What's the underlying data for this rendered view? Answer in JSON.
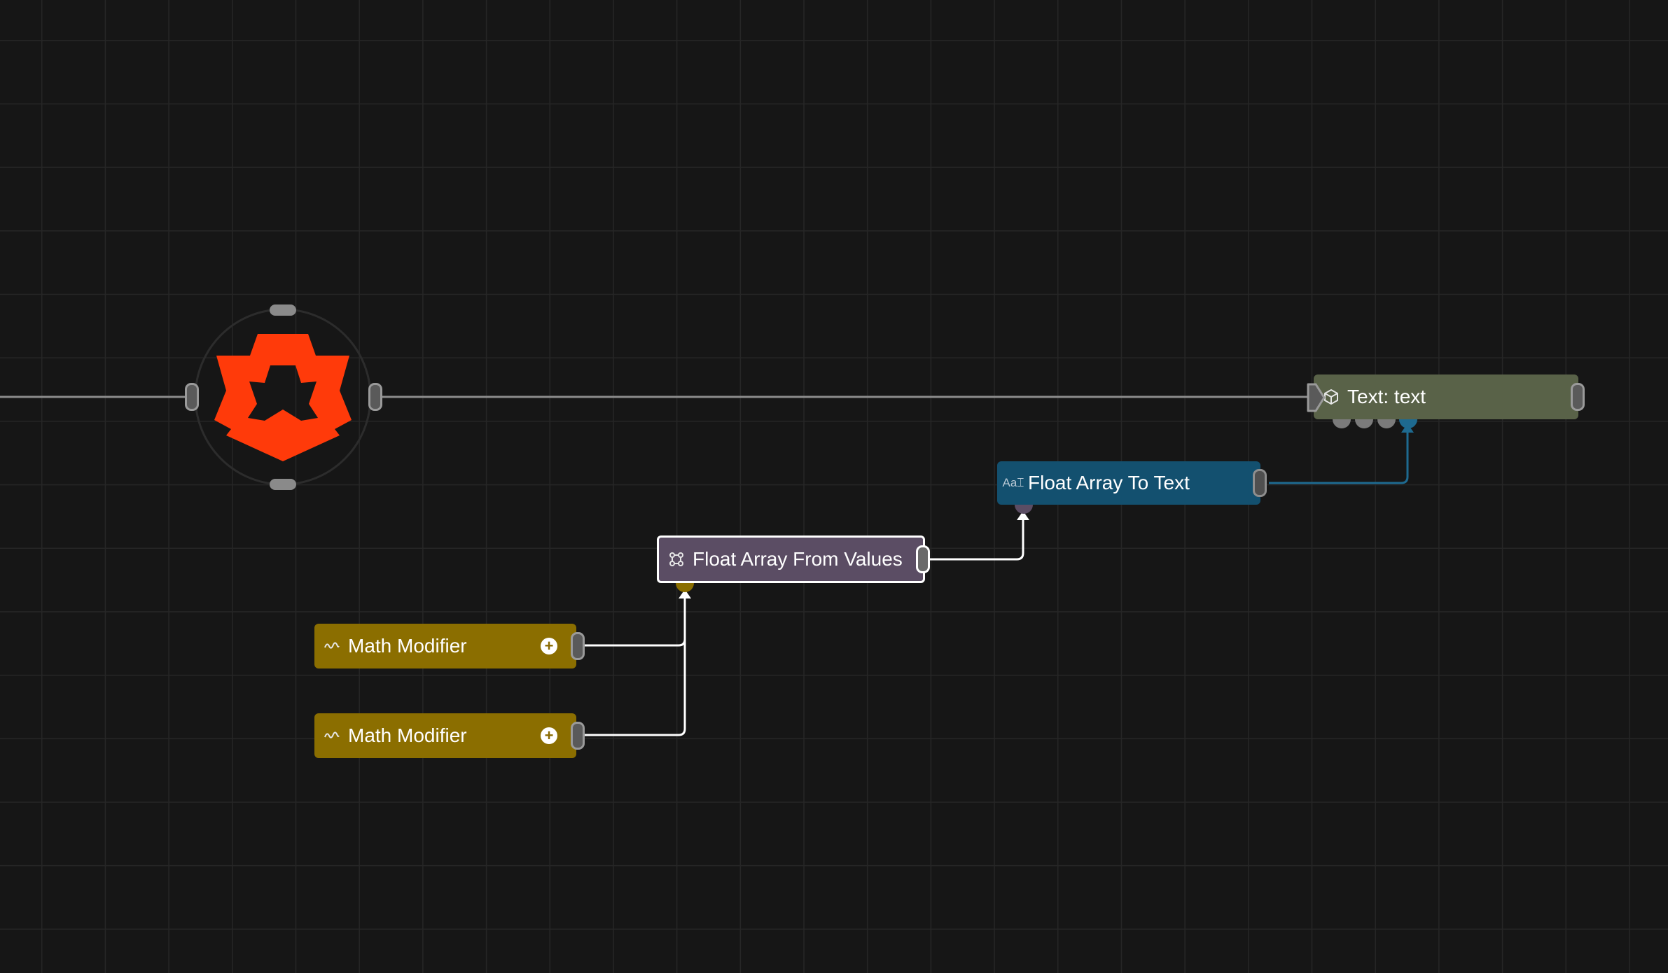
{
  "nodes": {
    "text": {
      "label": "Text: text",
      "icon": "cube-icon",
      "color": "#596248"
    },
    "float_array_to_text": {
      "label": "Float Array To Text",
      "icon": "text-format-icon",
      "color": "#13506f"
    },
    "float_array_from_values": {
      "label": "Float Array From Values",
      "icon": "array-icon",
      "color": "#5b4d64"
    },
    "math_modifier_1": {
      "label": "Math Modifier",
      "icon": "wave-icon",
      "color": "#8b6e00"
    },
    "math_modifier_2": {
      "label": "Math Modifier",
      "icon": "wave-icon",
      "color": "#8b6e00"
    }
  },
  "colors": {
    "background": "#161616",
    "grid": "#262626",
    "logo": "#ff3a0a",
    "wire_default": "#8c8c8c",
    "wire_selected": "#ffffff",
    "wire_text": "#1e6a90"
  }
}
